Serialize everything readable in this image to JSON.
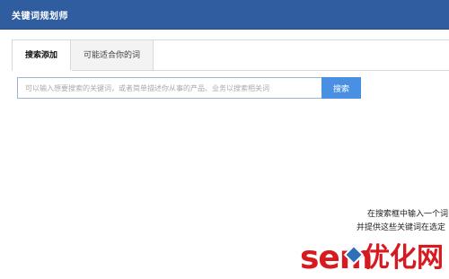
{
  "topbar": {
    "title": "关键词规划师"
  },
  "tabs": [
    {
      "label": "搜索添加",
      "active": true
    },
    {
      "label": "可能适合你的词",
      "active": false
    }
  ],
  "search": {
    "placeholder": "可以输入想要搜索的关键词，或者简单描述你从事的产品、业务以搜索相关词",
    "value": "",
    "button_label": "搜索"
  },
  "hint": {
    "line1": "在搜索框中输入一个词",
    "line2": "并提供这些关键词在选定"
  },
  "watermark": {
    "brand": "sem",
    "tagline": "优化网"
  },
  "colors": {
    "header_bg": "#2f5da0",
    "search_button": "#4a90e2",
    "watermark": "#d71920"
  }
}
